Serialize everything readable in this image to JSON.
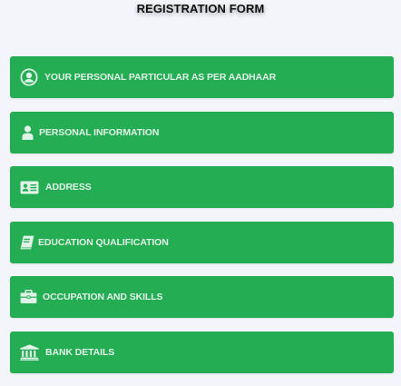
{
  "page": {
    "title": "REGISTRATION FORM"
  },
  "colors": {
    "bar": "#25ad54",
    "label": "#dff3e6",
    "background": "#f3f5fa"
  },
  "sections": [
    {
      "label": "YOUR PERSONAL PARTICULAR AS PER AADHAAR",
      "icon": "user-circle-icon"
    },
    {
      "label": "PERSONAL INFORMATION",
      "icon": "user-icon"
    },
    {
      "label": "ADDRESS",
      "icon": "address-card-icon"
    },
    {
      "label": "EDUCATION QUALIFICATION",
      "icon": "book-icon"
    },
    {
      "label": "OCCUPATION AND SKILLS",
      "icon": "briefcase-icon"
    },
    {
      "label": "BANK DETAILS",
      "icon": "bank-icon"
    }
  ]
}
